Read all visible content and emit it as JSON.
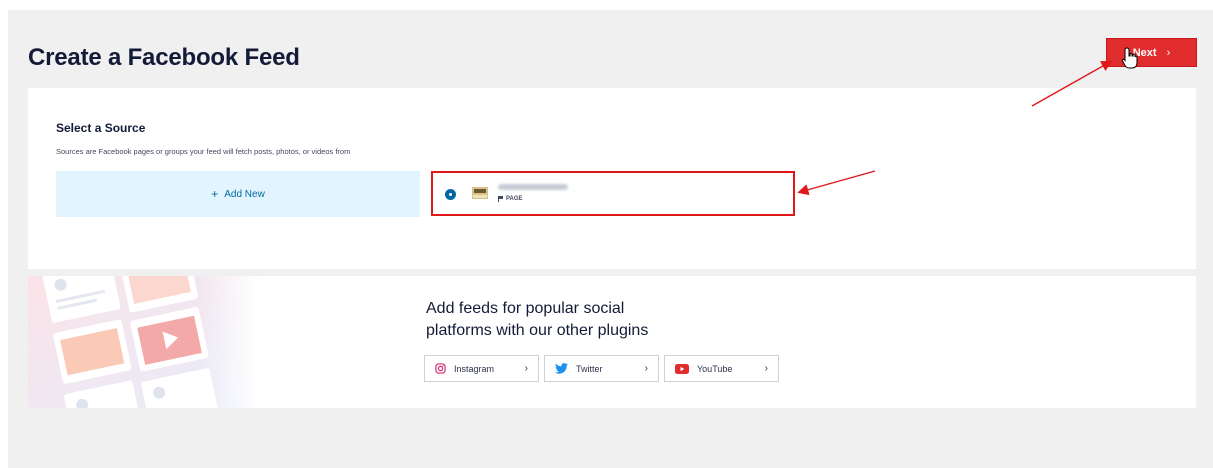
{
  "page": {
    "title": "Create a Facebook Feed",
    "next_label": "Next"
  },
  "source_section": {
    "title": "Select a Source",
    "description": "Sources are Facebook pages or groups your feed will fetch posts, photos, or videos from",
    "add_new_label": "Add New",
    "selected_source": {
      "type_label": "PAGE",
      "selected": true
    }
  },
  "promo": {
    "title_line1": "Add feeds for popular social",
    "title_line2": "platforms with our other plugins",
    "plugins": [
      {
        "label": "Instagram",
        "icon": "instagram-icon",
        "color": "#d22a77"
      },
      {
        "label": "Twitter",
        "icon": "twitter-icon",
        "color": "#1b90ef"
      },
      {
        "label": "YouTube",
        "icon": "youtube-icon",
        "color": "#e12d2d"
      }
    ]
  },
  "colors": {
    "accent": "#0068a0",
    "next_button": "#e12d2d",
    "annotation": "#e01818"
  }
}
